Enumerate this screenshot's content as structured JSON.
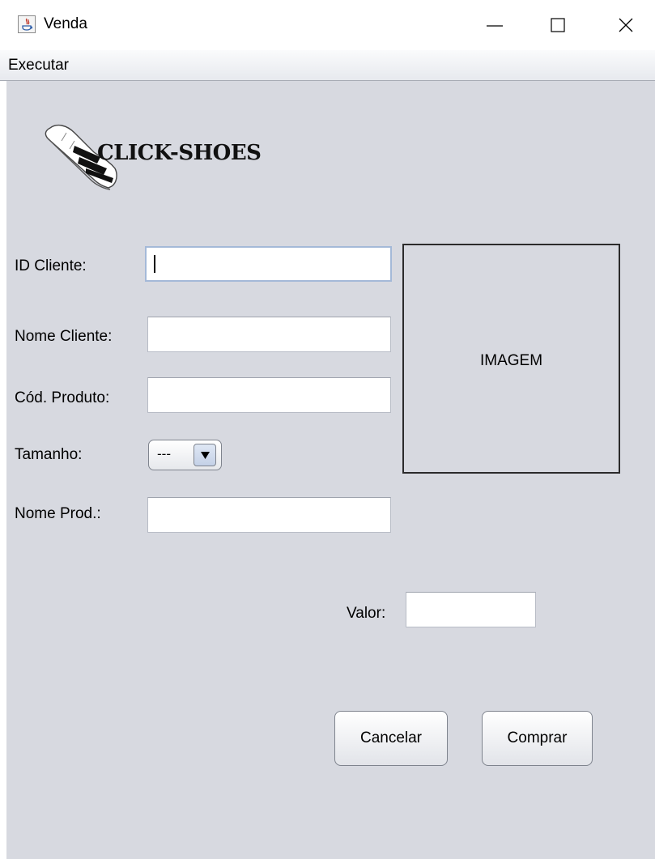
{
  "window": {
    "title": "Venda",
    "icon": "java-app-icon",
    "controls": [
      "minimize-icon",
      "maximize-icon",
      "close-icon"
    ]
  },
  "menu": {
    "items": [
      {
        "label": "Executar"
      }
    ]
  },
  "logo": {
    "text": "CLICK-SHOES",
    "icon": "sneaker-icon"
  },
  "form": {
    "id_cliente": {
      "label": "ID Cliente:",
      "value": ""
    },
    "nome_cliente": {
      "label": "Nome Cliente:",
      "value": ""
    },
    "cod_produto": {
      "label": "Cód. Produto:",
      "value": ""
    },
    "tamanho": {
      "label": "Tamanho:",
      "selected": "---"
    },
    "nome_prod": {
      "label": "Nome Prod.:",
      "value": ""
    },
    "valor": {
      "label": "Valor:",
      "value": ""
    }
  },
  "image_panel": {
    "label": "IMAGEM"
  },
  "buttons": {
    "cancel": "Cancelar",
    "buy": "Comprar"
  },
  "colors": {
    "content_bg": "#d7d9e0",
    "focus_border": "#a4b9d8"
  }
}
